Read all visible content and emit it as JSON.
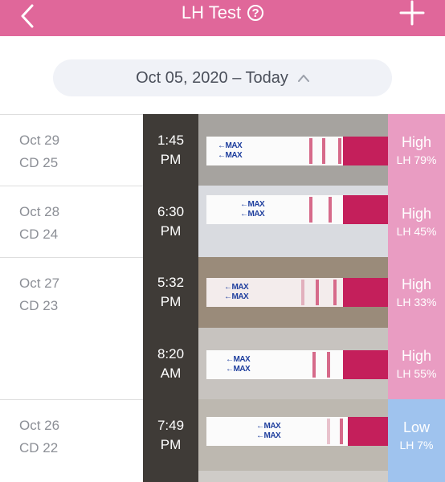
{
  "header": {
    "title": "LH Test",
    "help_icon": "?"
  },
  "date_range": "Oct 05, 2020 – Today",
  "days": [
    {
      "date": "Oct 29",
      "cd": "CD 25",
      "entries": [
        {
          "time": "1:45",
          "period": "PM",
          "level": "High",
          "lh": "LH 79%",
          "status": "high"
        }
      ]
    },
    {
      "date": "Oct 28",
      "cd": "CD 24",
      "entries": [
        {
          "time": "6:30",
          "period": "PM",
          "level": "High",
          "lh": "LH 45%",
          "status": "high"
        }
      ]
    },
    {
      "date": "Oct 27",
      "cd": "CD 23",
      "entries": [
        {
          "time": "5:32",
          "period": "PM",
          "level": "High",
          "lh": "LH 33%",
          "status": "high"
        },
        {
          "time": "8:20",
          "period": "AM",
          "level": "High",
          "lh": "LH 55%",
          "status": "high"
        }
      ]
    },
    {
      "date": "Oct 26",
      "cd": "CD 22",
      "entries": [
        {
          "time": "7:49",
          "period": "PM",
          "level": "Low",
          "lh": "LH 7%",
          "status": "low"
        }
      ]
    }
  ],
  "strip_text": "←MAX"
}
